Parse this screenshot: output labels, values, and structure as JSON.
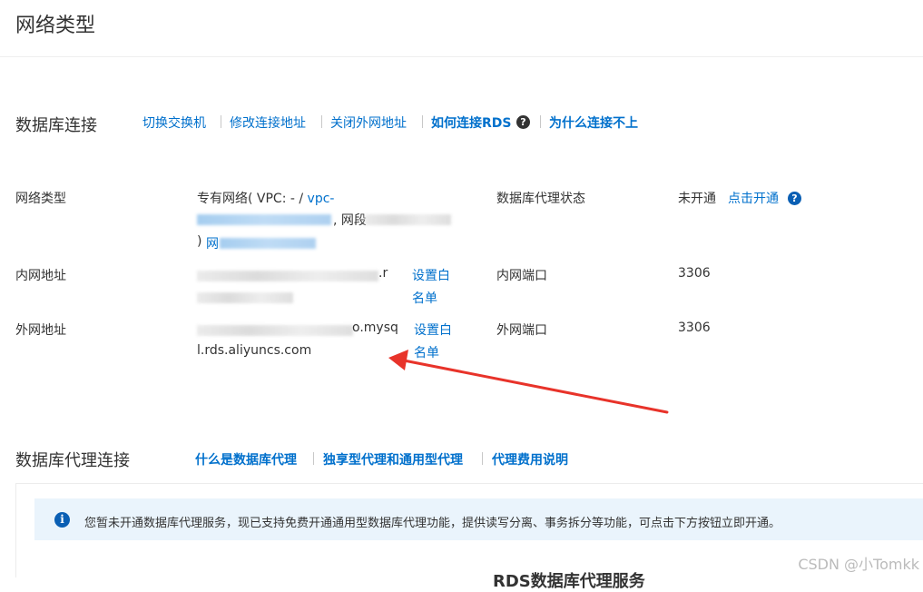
{
  "page_title": "网络类型",
  "connection": {
    "title": "数据库连接",
    "links": [
      "切换交换机",
      "修改连接地址",
      "关闭外网地址",
      "如何连接RDS",
      "为什么连接不上"
    ],
    "help_icon": "question-circle-icon"
  },
  "network": {
    "type_label": "网络类型",
    "type_value_prefix": "专有网络( VPC: - / ",
    "vpc_link": "vpc-",
    "segment_text": ", 网段",
    "paren_close": ")",
    "network_link": "网",
    "proxy_status_label": "数据库代理状态",
    "proxy_status_value": "未开通",
    "proxy_open_link": "点击开通",
    "intranet_label": "内网地址",
    "intranet_value_line1": ".r",
    "set_whitelist": [
      "设置白",
      "名单"
    ],
    "intranet_port_label": "内网端口",
    "intranet_port_value": "3306",
    "internet_label": "外网地址",
    "internet_value_line1": "o.mysq",
    "internet_value_line2": "l.rds.aliyuncs.com",
    "internet_port_label": "外网端口",
    "internet_port_value": "3306"
  },
  "proxy": {
    "title": "数据库代理连接",
    "links": [
      "什么是数据库代理",
      "独享型代理和通用型代理",
      "代理费用说明"
    ],
    "notice_icon": "info-circle-icon",
    "notice_text": "您暂未开通数据库代理服务，现已支持免费开通通用型数据库代理功能，提供读写分离、事务拆分等功能，可点击下方按钮立即开通。",
    "panel_heading": "RDS数据库代理服务"
  },
  "watermark": "CSDN @小Tomkk",
  "colors": {
    "link": "#0070cc",
    "arrow": "#e8332a",
    "help_icon_bg": "#0a5fb4",
    "notice_bg": "#eaf4fc"
  }
}
